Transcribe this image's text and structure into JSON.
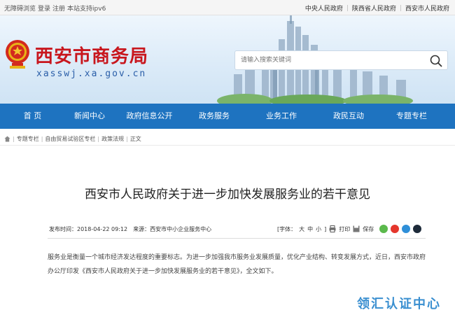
{
  "topbar": {
    "left": [
      "无障碍浏览",
      "登录",
      "注册",
      "本站支持ipv6"
    ],
    "right": [
      "中央人民政府",
      "陕西省人民政府",
      "西安市人民政府"
    ]
  },
  "header": {
    "title": "西安市商务局",
    "domain": "xasswj.xa.gov.cn",
    "search_placeholder": "请输入搜索关键词"
  },
  "nav": [
    "首 页",
    "新闻中心",
    "政府信息公开",
    "政务服务",
    "业务工作",
    "政民互动",
    "专题专栏"
  ],
  "breadcrumb": [
    "专题专栏",
    "自由贸易试验区专栏",
    "政策法规",
    "正文"
  ],
  "article": {
    "title": "西安市人民政府关于进一步加快发展服务业的若干意见",
    "published_label": "发布时间：",
    "published_value": "2018-04-22 09:12",
    "source_label": "来源：",
    "source_value": "西安市中小企业服务中心",
    "font_label": "[字体：",
    "font_big": "大",
    "font_mid": "中",
    "font_small": "小",
    "font_close": "]",
    "print_label": "打印",
    "save_label": "保存",
    "body": "服务业是衡量一个城市经济发达程度的重要标志。为进一步加强我市服务业发展质量，优化产业结构、转变发展方式，近日，西安市政府办公厅印发《西安市人民政府关于进一步加快发展服务业的若干意见》，全文如下。"
  },
  "watermark": "领汇认证中心",
  "colors": {
    "nav_blue": "#1e73c0",
    "title_red": "#c8161d",
    "domain_blue": "#2a5ea8"
  }
}
